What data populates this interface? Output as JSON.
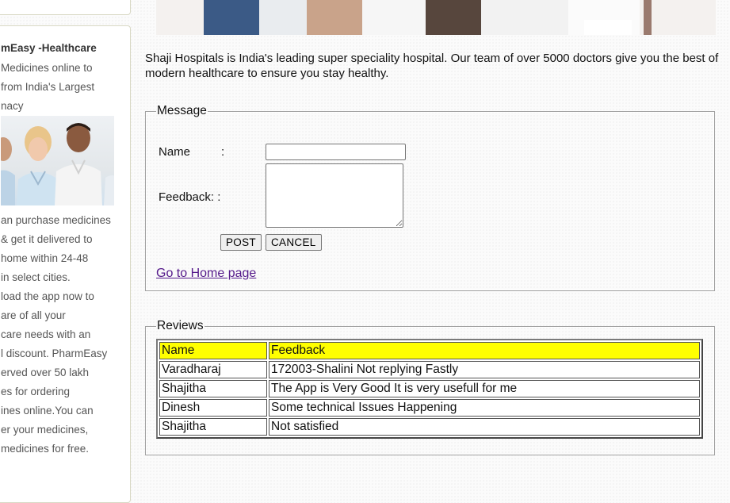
{
  "sidebar": {
    "ad_title": "mEasy -Healthcare",
    "ad_lines_top": [
      "Medicines online to",
      "from India's Largest",
      "nacy"
    ],
    "ad_lines_bottom": [
      "an purchase medicines",
      "& get it delivered to",
      "home within 24-48",
      "in select cities.",
      "load the app now to",
      "are of all your",
      "care needs with an",
      "l discount. PharmEasy",
      "erved over 50 lakh",
      "es for ordering",
      "ines online.You can",
      "er your medicines,",
      "medicines for free."
    ]
  },
  "intro": {
    "text": "Shaji Hospitals is India's leading super speciality hospital. Our team of over 5000 doctors give you the best of modern healthcare to ensure you stay healthy."
  },
  "message_form": {
    "legend": "Message",
    "name_label": "Name",
    "name_colon": ":",
    "name_value": "",
    "feedback_label": "Feedback: :",
    "feedback_value": "",
    "post_label": "POST",
    "cancel_label": "CANCEL",
    "home_link": "Go to Home page"
  },
  "reviews": {
    "legend": "Reviews",
    "headers": [
      "Name",
      "Feedback"
    ],
    "header_color": "#ffff00",
    "rows": [
      [
        "Varadharaj",
        "172003-Shalini Not replying Fastly"
      ],
      [
        "Shajitha",
        "The App is Very Good It is very usefull for me"
      ],
      [
        "Dinesh",
        "Some technical Issues Happening"
      ],
      [
        "Shajitha",
        "Not satisfied"
      ]
    ]
  },
  "colors": {
    "link_visited": "#551a8b",
    "table_header_bg": "#ffff00"
  }
}
